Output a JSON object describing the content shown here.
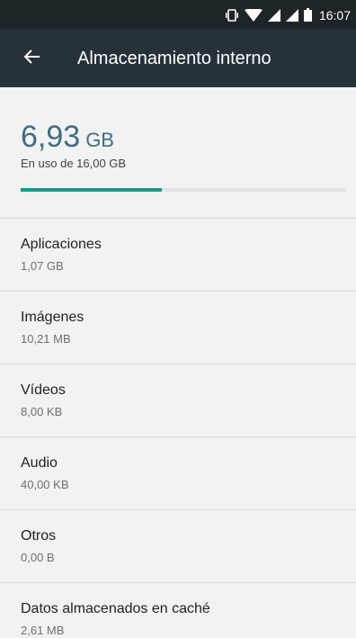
{
  "status_bar": {
    "time": "16:07",
    "icons": [
      "vibrate-icon",
      "wifi-icon",
      "signal-icon",
      "signal-icon",
      "battery-icon"
    ]
  },
  "app_bar": {
    "title": "Almacenamiento interno",
    "back_icon": "back-arrow-icon"
  },
  "summary": {
    "used_value": "6,93",
    "used_unit": "GB",
    "used_of": "En uso de 16,00 GB",
    "progress_fraction": 0.433
  },
  "items": [
    {
      "title": "Aplicaciones",
      "size": "1,07 GB"
    },
    {
      "title": "Imágenes",
      "size": "10,21 MB"
    },
    {
      "title": "Vídeos",
      "size": "8,00 KB"
    },
    {
      "title": "Audio",
      "size": "40,00 KB"
    },
    {
      "title": "Otros",
      "size": "0,00 B"
    },
    {
      "title": "Datos almacenados en caché",
      "size": "2,61 MB"
    }
  ],
  "colors": {
    "status_bar": "#1e2528",
    "app_bar": "#263238",
    "accent": "#169a8a",
    "used_text": "#3d6e84"
  }
}
